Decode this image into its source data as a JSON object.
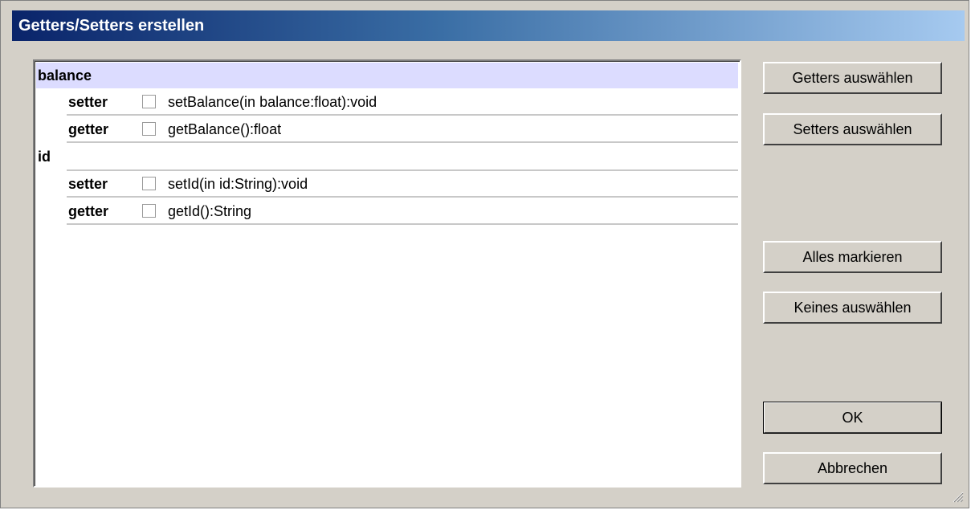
{
  "window": {
    "title": "Getters/Setters erstellen"
  },
  "list": {
    "groups": [
      {
        "name": "balance",
        "items": [
          {
            "kind": "setter",
            "signature": "setBalance(in balance:float):void",
            "checked": false
          },
          {
            "kind": "getter",
            "signature": "getBalance():float",
            "checked": false
          }
        ]
      },
      {
        "name": "id",
        "items": [
          {
            "kind": "setter",
            "signature": "setId(in id:String):void",
            "checked": false
          },
          {
            "kind": "getter",
            "signature": "getId():String",
            "checked": false
          }
        ]
      }
    ]
  },
  "buttons": {
    "select_getters": "Getters auswählen",
    "select_setters": "Setters auswählen",
    "select_all": "Alles markieren",
    "select_none": "Keines auswählen",
    "ok": "OK",
    "cancel": "Abbrechen"
  },
  "colors": {
    "dialog_bg": "#d4d0c8",
    "titlebar_start": "#0a246a",
    "titlebar_end": "#a6caf0",
    "selected_row": "#dcdcff"
  }
}
